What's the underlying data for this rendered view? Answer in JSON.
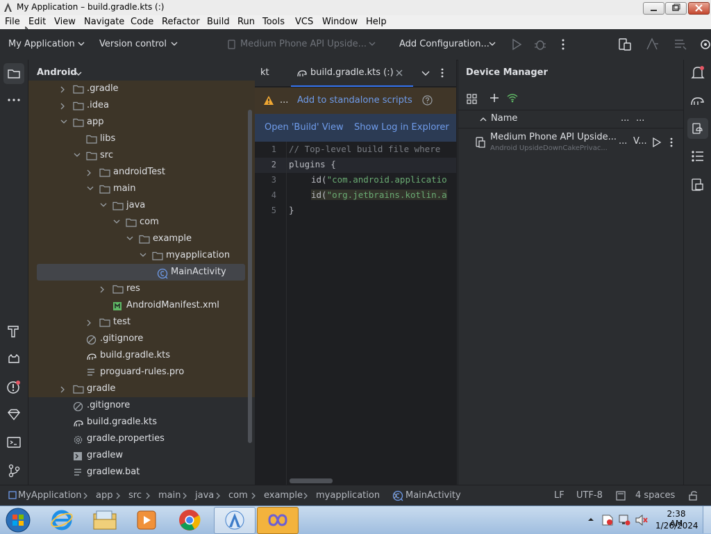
{
  "window": {
    "title": "My Application – build.gradle.kts (:)"
  },
  "menu": [
    "File",
    "Edit",
    "View",
    "Navigate",
    "Code",
    "Refactor",
    "Build",
    "Run",
    "Tools",
    "VCS",
    "Window",
    "Help"
  ],
  "toolbar": {
    "project": "My Application",
    "vcs": "Version control",
    "device": "Medium Phone API Upside...",
    "config": "Add Configuration..."
  },
  "project_panel": {
    "view": "Android",
    "tree": [
      {
        "label": ".gradle"
      },
      {
        "label": ".idea"
      },
      {
        "label": "app"
      },
      {
        "label": "libs"
      },
      {
        "label": "src"
      },
      {
        "label": "androidTest"
      },
      {
        "label": "main"
      },
      {
        "label": "java"
      },
      {
        "label": "com"
      },
      {
        "label": "example"
      },
      {
        "label": "myapplication"
      },
      {
        "label": "MainActivity"
      },
      {
        "label": "res"
      },
      {
        "label": "AndroidManifest.xml"
      },
      {
        "label": "test"
      },
      {
        "label": ".gitignore"
      },
      {
        "label": "build.gradle.kts"
      },
      {
        "label": "proguard-rules.pro"
      },
      {
        "label": "gradle"
      },
      {
        "label": ".gitignore"
      },
      {
        "label": "build.gradle.kts"
      },
      {
        "label": "gradle.properties"
      },
      {
        "label": "gradlew"
      },
      {
        "label": "gradlew.bat"
      }
    ]
  },
  "editor": {
    "tabs": [
      {
        "label": "kt"
      },
      {
        "label": "build.gradle.kts (:)"
      }
    ],
    "banner_warning": {
      "ellipsis": "...",
      "link": "Add to standalone scripts"
    },
    "banner_build": {
      "link1": "Open 'Build' View",
      "link2": "Show Log in Explorer"
    },
    "lines": [
      {
        "num": "1",
        "text": "// Top-level build file where"
      },
      {
        "num": "2",
        "kw": "plugins {"
      },
      {
        "num": "3",
        "pre": "id(",
        "str": "\"com.android.applicatio"
      },
      {
        "num": "4",
        "pre": "id(",
        "str": "\"org.jetbrains.kotlin.a"
      },
      {
        "num": "5",
        "text": "}"
      }
    ]
  },
  "device_manager": {
    "title": "Device Manager",
    "col_name": "Name",
    "col_more1": "...",
    "col_more2": "...",
    "device_name": "Medium Phone API Upside...",
    "device_sub": "Android UpsideDownCakePrivac...",
    "device_more": "...",
    "device_v": "V..."
  },
  "status": {
    "breadcrumb": [
      "MyApplication",
      "app",
      "src",
      "main",
      "java",
      "com",
      "example",
      "myapplication",
      "MainActivity"
    ],
    "lf": "LF",
    "encoding": "UTF-8",
    "indent": "4 spaces"
  },
  "taskbar": {
    "time": "2:38 AM",
    "date": "1/26/2024"
  },
  "colors": {
    "accent": "#3574f0",
    "folder": "#9aa0a6",
    "warning": "#f0a732",
    "link": "#6f9ceb"
  }
}
